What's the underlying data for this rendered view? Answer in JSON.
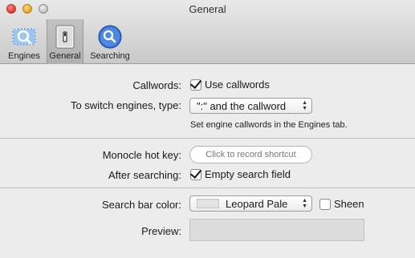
{
  "window": {
    "title": "General"
  },
  "toolbar": {
    "items": [
      {
        "label": "Engines",
        "icon": "engines-icon"
      },
      {
        "label": "General",
        "icon": "general-icon"
      },
      {
        "label": "Searching",
        "icon": "searching-icon"
      }
    ],
    "selected": "General"
  },
  "callwords": {
    "label": "Callwords:",
    "checkbox_label": "Use callwords",
    "checked": true
  },
  "switch": {
    "label": "To switch engines, type:",
    "value": "\":\" and the callword",
    "hint": "Set engine callwords in the Engines tab."
  },
  "hotkey": {
    "label": "Monocle hot key:",
    "placeholder": "Click to record shortcut"
  },
  "after": {
    "label": "After searching:",
    "checkbox_label": "Empty search field",
    "checked": true
  },
  "color": {
    "label": "Search bar color:",
    "value": "Leopard Pale",
    "sheen_label": "Sheen",
    "sheen_checked": false
  },
  "preview": {
    "label": "Preview:"
  }
}
